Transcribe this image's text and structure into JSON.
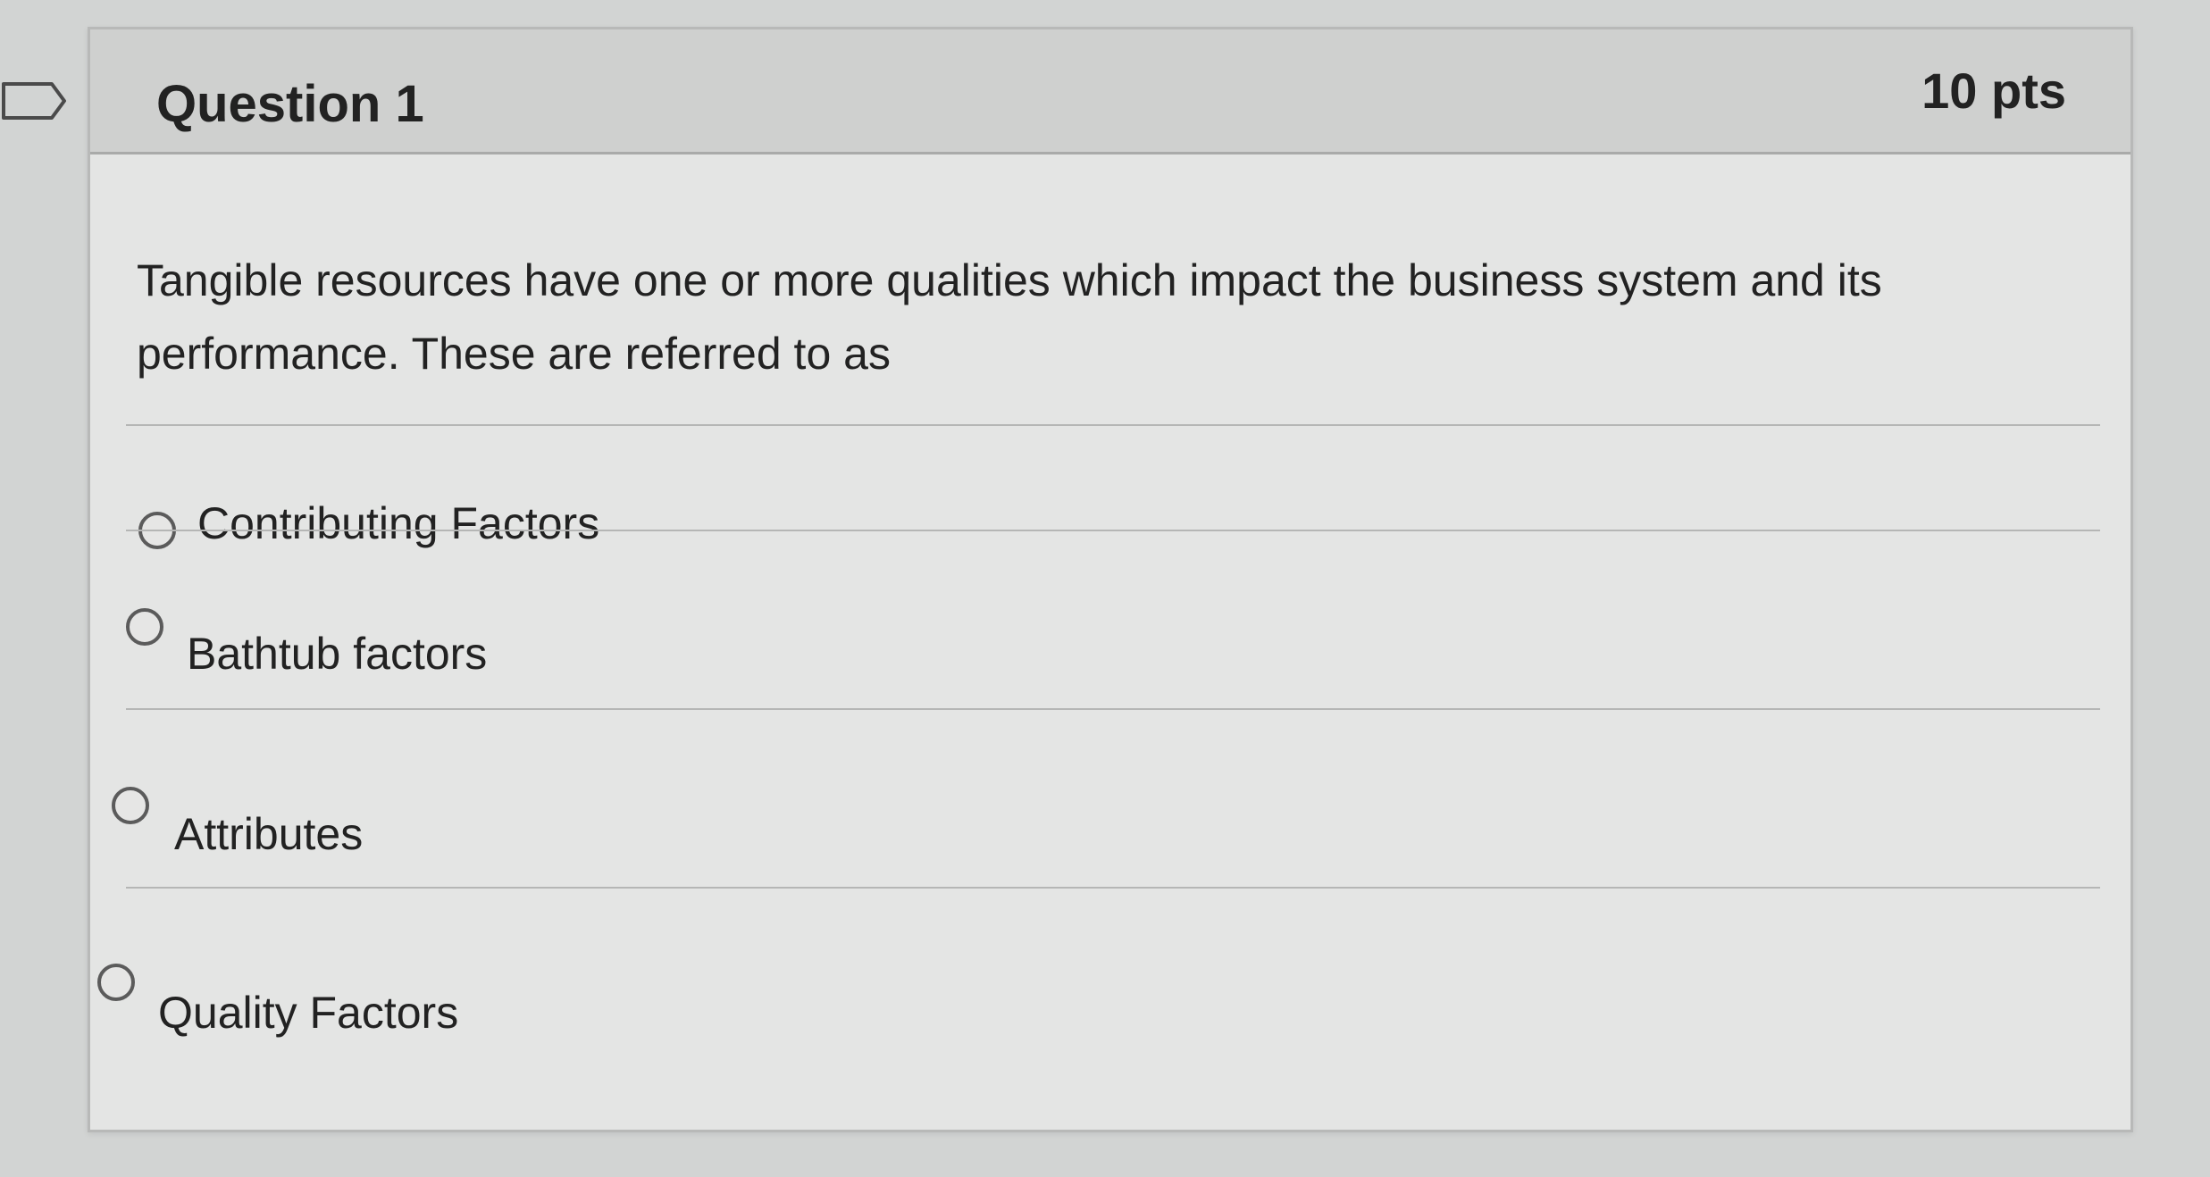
{
  "question": {
    "title": "Question 1",
    "points": "10 pts",
    "text": "Tangible resources have one or more qualities which impact the business system and its performance. These are referred to as",
    "answers": [
      {
        "label": "Contributing Factors"
      },
      {
        "label": "Bathtub factors"
      },
      {
        "label": "Attributes"
      },
      {
        "label": "Quality Factors"
      }
    ]
  },
  "icons": {
    "flag": "flag-icon"
  }
}
